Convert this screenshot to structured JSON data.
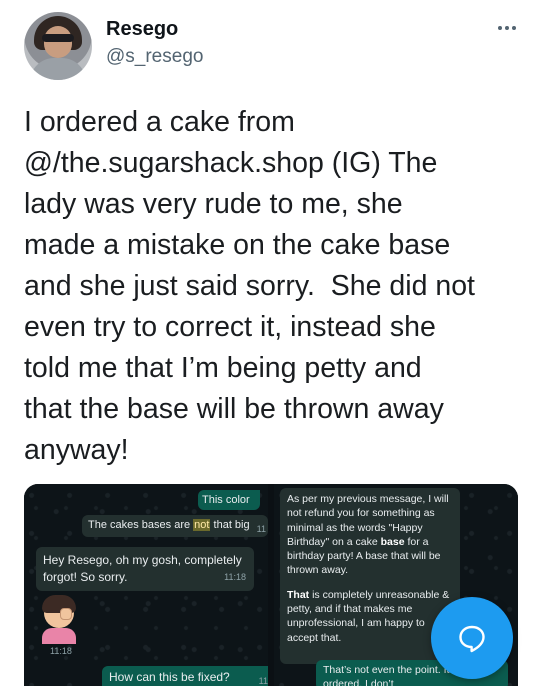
{
  "user": {
    "name": "Resego",
    "handle": "@s_resego"
  },
  "tweet": {
    "text": "I ordered a cake from\n@/the.sugarshack.shop (IG) The\nlady was very rude to me, she\nmade a mistake on the cake base\nand she just said sorry.  She did not\neven try to correct it, instead she\ntold me that I’m being petty and\nthat the base will be thrown away\nanyway!"
  },
  "left_chat": {
    "msg1": "This color",
    "msg2_before": "The cakes bases are ",
    "msg2_highlight": "not",
    "msg2_after": " that big",
    "msg2_time": "11",
    "msg3": "Hey Resego, oh my gosh, completely forgot! So sorry.",
    "msg3_time": "11:18",
    "sticker_time": "11:18",
    "msg4": "How can this be fixed?",
    "msg4_time": "11"
  },
  "right_chat": {
    "p1_a": "As per my previous message, I will not refund you for something as minimal as the words \"Happy Birthday\" on a cake ",
    "p1_bold": "base",
    "p1_b": " for a birthday party! A base that will be thrown away.",
    "p2_bold": "That",
    "p2_rest": " is completely unreasonable & petty, and if that makes me unprofessional, I am happy to accept that.",
    "msg2": "That’s not even the point. It is what I ordered. I don’t"
  },
  "colors": {
    "accent": "#1d9bf0",
    "outgoing_bubble": "#0b5c4f",
    "incoming_bubble": "#23302f"
  },
  "icons": [
    "more-dots-icon",
    "compose-reply-fab-icon"
  ]
}
